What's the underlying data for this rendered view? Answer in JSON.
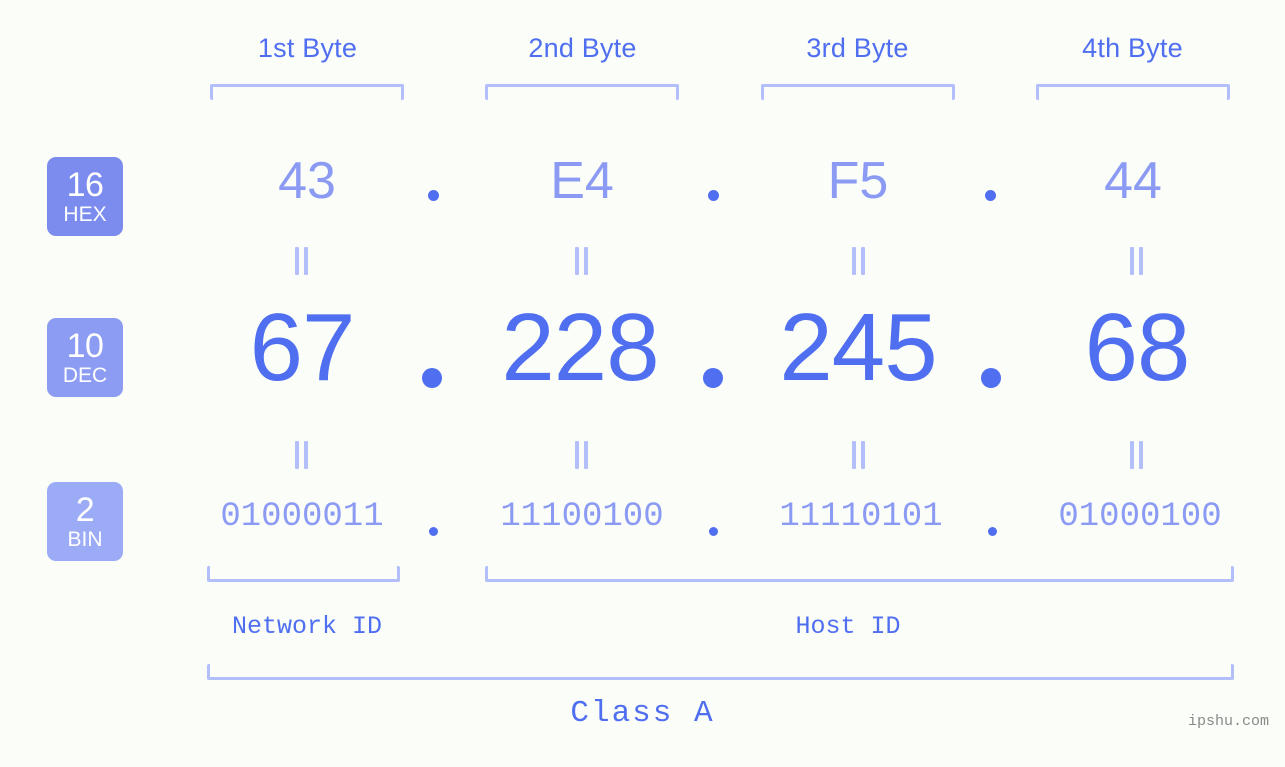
{
  "byte_headers": [
    {
      "label": "1st Byte"
    },
    {
      "label": "2nd Byte"
    },
    {
      "label": "3rd Byte"
    },
    {
      "label": "4th Byte"
    }
  ],
  "rows": {
    "hex": {
      "badge_number": "16",
      "badge_word": "HEX",
      "badge_color": "#7b8cee",
      "values": [
        "43",
        "E4",
        "F5",
        "44"
      ],
      "separator": "."
    },
    "dec": {
      "badge_number": "10",
      "badge_word": "DEC",
      "badge_color": "#8c9cf2",
      "values": [
        "67",
        "228",
        "245",
        "68"
      ],
      "separator": "."
    },
    "bin": {
      "badge_number": "2",
      "badge_word": "BIN",
      "badge_color": "#9babf6",
      "values": [
        "01000011",
        "11100100",
        "11110101",
        "01000100"
      ],
      "separator": "."
    }
  },
  "equality_marks": {
    "glyph": "||",
    "count_per_row": 4
  },
  "segments": [
    {
      "label": "Network ID"
    },
    {
      "label": "Host ID"
    }
  ],
  "class_label": "Class A",
  "watermark": "ipshu.com",
  "colors": {
    "background": "#fbfdf8",
    "accent_strong": "#4f6ef0",
    "accent_light": "#8b9bf3",
    "bracket": "#b3bffa"
  }
}
